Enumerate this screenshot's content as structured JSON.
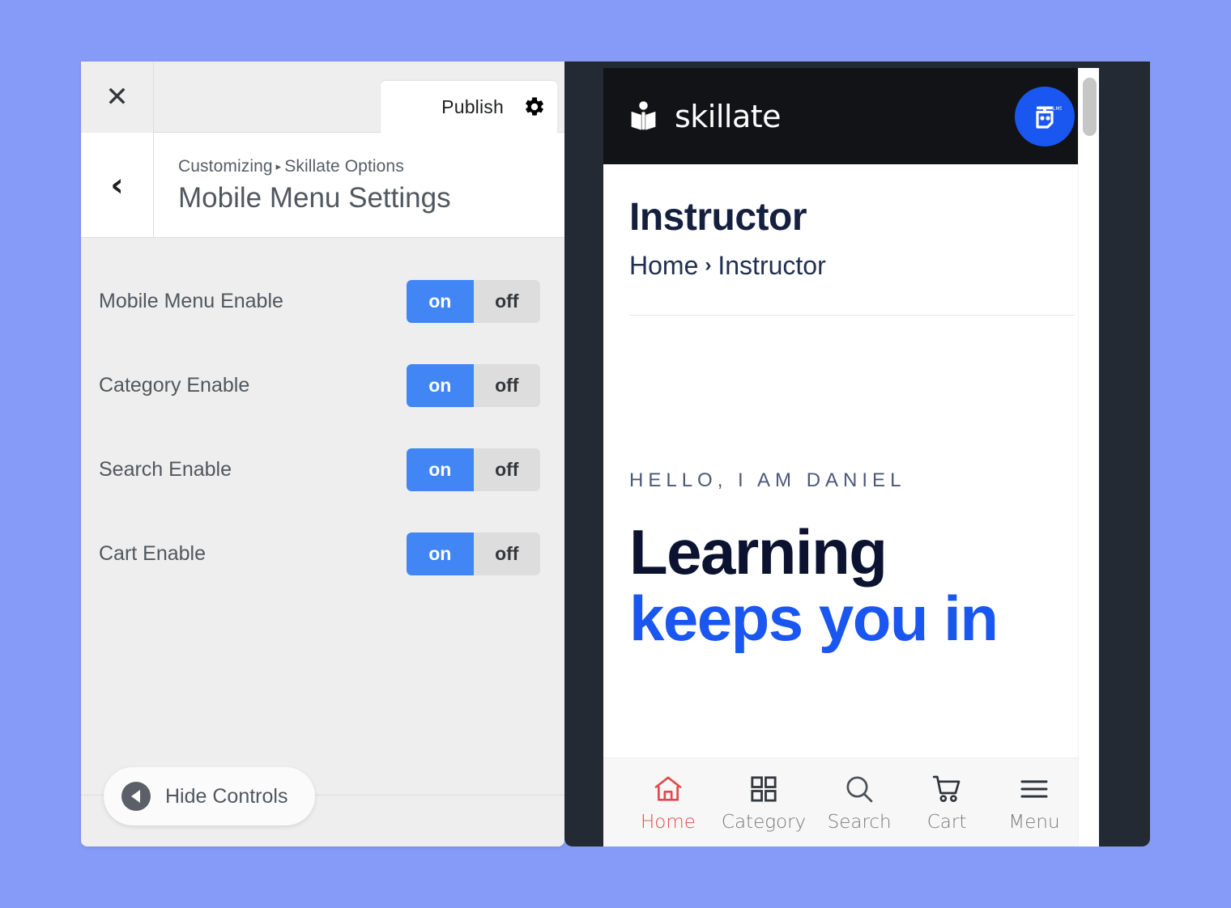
{
  "theme": {
    "page_background": "#859bf7",
    "accent_blue": "#4285f4",
    "brand_blue": "#1a56f0",
    "active_nav": "#e04a4a",
    "device_frame": "#232a33",
    "site_header_bg": "#111317"
  },
  "customizer": {
    "close_label": "✕",
    "back_label": "‹",
    "publish_label": "Publish",
    "gear_icon": "gear-icon",
    "breadcrumb": {
      "root": "Customizing",
      "separator": "▸",
      "section": "Skillate Options"
    },
    "title": "Mobile Menu Settings",
    "settings": [
      {
        "label": "Mobile Menu Enable",
        "on_label": "on",
        "off_label": "off",
        "value": "on"
      },
      {
        "label": "Category Enable",
        "on_label": "on",
        "off_label": "off",
        "value": "on"
      },
      {
        "label": "Search Enable",
        "on_label": "on",
        "off_label": "off",
        "value": "on"
      },
      {
        "label": "Cart Enable",
        "on_label": "on",
        "off_label": "off",
        "value": "on"
      }
    ],
    "hide_controls_label": "Hide Controls",
    "hide_controls_icon": "collapse-left-icon"
  },
  "preview": {
    "header": {
      "brand_name": "skillate",
      "brand_icon": "book-reader-logo-icon",
      "badge_icon": "lms-badge-icon"
    },
    "page": {
      "title": "Instructor",
      "breadcrumb": {
        "home": "Home",
        "separator": "›",
        "current": "Instructor"
      }
    },
    "hero": {
      "eyebrow": "HELLO, I AM DANIEL",
      "line1": "Learning",
      "line2": "keeps you in"
    },
    "bottom_nav": [
      {
        "label": "Home",
        "icon": "home-icon",
        "active": true
      },
      {
        "label": "Category",
        "icon": "grid-icon",
        "active": false
      },
      {
        "label": "Search",
        "icon": "search-icon",
        "active": false
      },
      {
        "label": "Cart",
        "icon": "cart-icon",
        "active": false
      },
      {
        "label": "Menu",
        "icon": "hamburger-icon",
        "active": false
      }
    ]
  }
}
